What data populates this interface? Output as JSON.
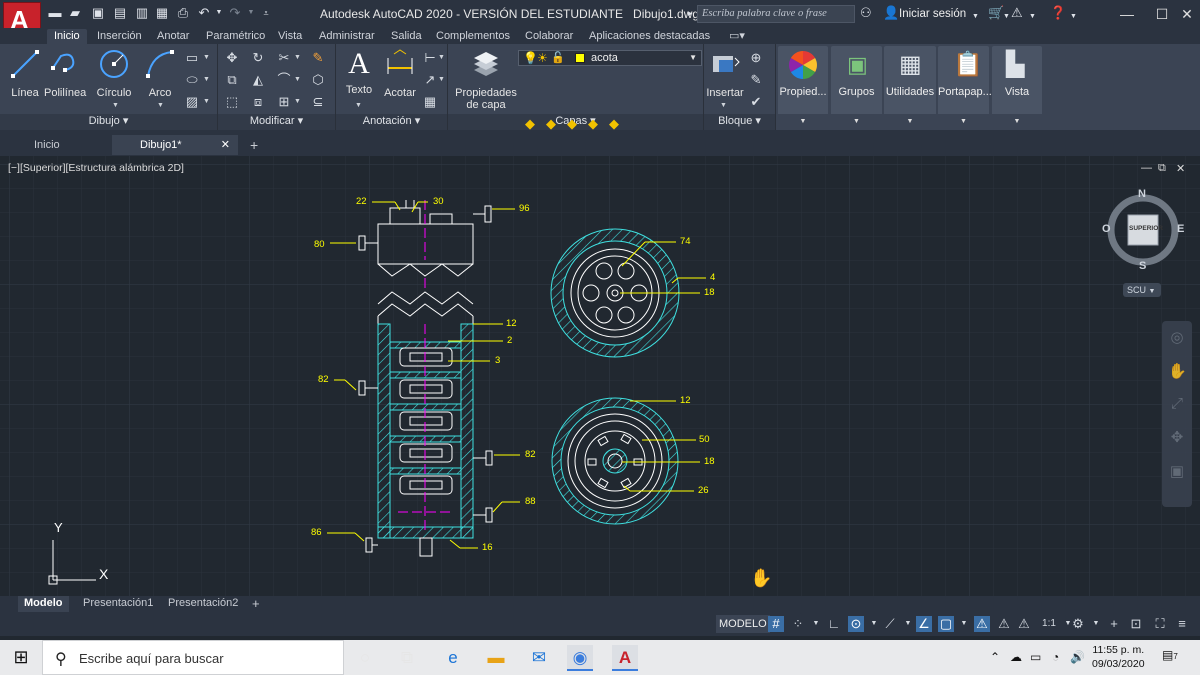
{
  "app": {
    "logo_letter": "A",
    "title": "Autodesk AutoCAD 2020 - VERSIÓN DEL ESTUDIANTE",
    "filename": "Dibujo1.dwg",
    "search_placeholder": "Escriba palabra clave o frase",
    "signin": "Iniciar sesión"
  },
  "ribbon_tabs": [
    "Inicio",
    "Inserción",
    "Anotar",
    "Paramétrico",
    "Vista",
    "Administrar",
    "Salida",
    "Complementos",
    "Colaborar",
    "Aplicaciones destacadas"
  ],
  "ribbon": {
    "dibujo": {
      "title": "Dibujo",
      "tools": [
        "Línea",
        "Polilínea",
        "Círculo",
        "Arco"
      ]
    },
    "modificar": {
      "title": "Modificar"
    },
    "anotacion": {
      "title": "Anotación",
      "tools": [
        "Texto",
        "Acotar"
      ]
    },
    "capas": {
      "title": "Capas",
      "props_label_1": "Propiedades",
      "props_label_2": "de capa",
      "current_layer": "acota"
    },
    "bloque": {
      "title": "Bloque",
      "insert_label": "Insertar"
    },
    "side_panels": [
      "Propied...",
      "Grupos",
      "Utilidades",
      "Portapap...",
      "Vista"
    ]
  },
  "doc_tabs": [
    "Inicio",
    "Dibujo1*"
  ],
  "viewport": {
    "label": "[−][Superior][Estructura alámbrica 2D]",
    "viewcube": {
      "face": "SUPERIOR",
      "north": "N",
      "south": "S",
      "east": "E",
      "west": "O"
    },
    "scu": "SCU",
    "ucs_x": "X",
    "ucs_y": "Y"
  },
  "drawing_labels": [
    "22",
    "30",
    "96",
    "80",
    "12",
    "2",
    "3",
    "82",
    "82",
    "88",
    "86",
    "16",
    "74",
    "4",
    "18",
    "12",
    "50",
    "18",
    "26"
  ],
  "layout_tabs": [
    "Modelo",
    "Presentación1",
    "Presentación2"
  ],
  "status": {
    "modelo": "MODELO",
    "scale": "1:1"
  },
  "taskbar": {
    "search_text": "Escribe aquí para buscar",
    "time": "11:55 p. m.",
    "date": "09/03/2020",
    "notifications": "7"
  },
  "colors": {
    "accent": "#3a6ea5",
    "drawing_cyan": "#3fe0e0",
    "label_yellow": "#ffff00",
    "axis_magenta": "#ff00ff"
  }
}
